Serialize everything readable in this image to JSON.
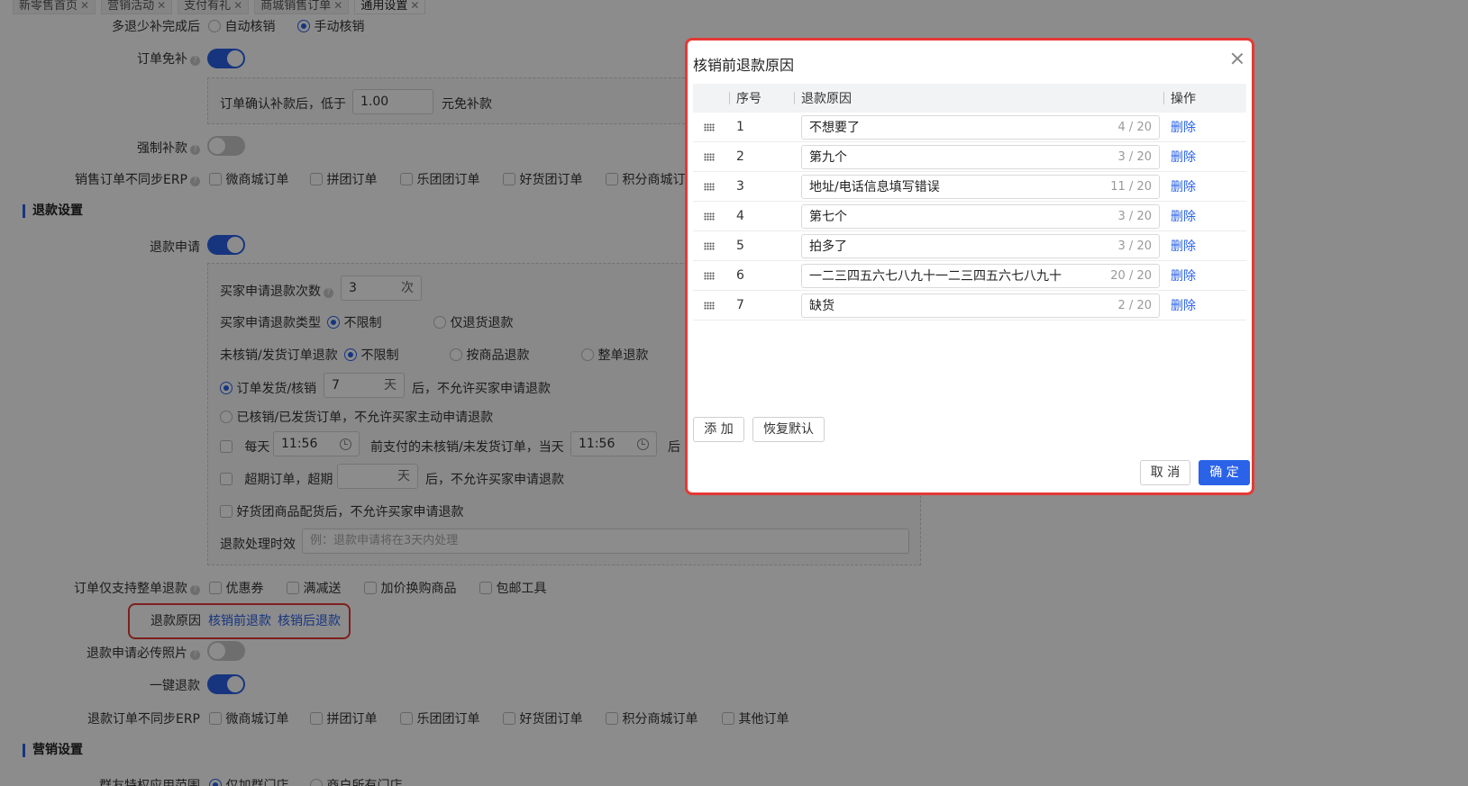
{
  "tabs": [
    {
      "label": "新零售首页",
      "active": false
    },
    {
      "label": "营销活动",
      "active": false
    },
    {
      "label": "支付有礼",
      "active": false
    },
    {
      "label": "商城销售订单",
      "active": false
    },
    {
      "label": "通用设置",
      "active": true
    }
  ],
  "tab_close": "✕",
  "settings": {
    "multi_refund": {
      "label": "多退少补完成后",
      "opt_auto": "自动核销",
      "opt_manual": "手动核销"
    },
    "exempt": {
      "label": "订单免补",
      "box_prefix": "订单确认补款后，低于",
      "value": "1.00",
      "box_suffix": "元免补款"
    },
    "force_refund": {
      "label": "强制补款"
    },
    "erp_sync": {
      "label": "销售订单不同步ERP",
      "options": [
        "微商城订单",
        "拼团订单",
        "乐团团订单",
        "好货团订单",
        "积分商城订"
      ]
    },
    "refund_section": "退款设置",
    "refund_apply": {
      "label": "退款申请"
    },
    "buyer_count": {
      "label": "买家申请退款次数",
      "value": "3",
      "unit": "次"
    },
    "buyer_type": {
      "label": "买家申请退款类型",
      "opt1": "不限制",
      "opt2": "仅退货退款"
    },
    "unverified": {
      "label": "未核销/发货订单退款",
      "opt1": "不限制",
      "opt2": "按商品退款",
      "opt3": "整单退款"
    },
    "after_ship": {
      "prefix": "订单发货/核销",
      "value": "7",
      "unit": "天",
      "suffix": "后，不允许买家申请退款"
    },
    "verified_no": "已核销/已发货订单，不允许买家主动申请退款",
    "daily": {
      "prefix": "每天",
      "time1": "11:56",
      "mid": "前支付的未核销/未发货订单，当天",
      "time2": "11:56",
      "suffix": "后"
    },
    "overdue": {
      "prefix": "超期订单，超期",
      "unit": "天",
      "suffix": "后，不允许买家申请退款"
    },
    "group_goods": "好货团商品配货后，不允许买家申请退款",
    "process_time": {
      "label": "退款处理时效",
      "placeholder": "例：退款申请将在3天内处理"
    },
    "whole_only": {
      "label": "订单仅支持整单退款",
      "options": [
        "优惠券",
        "满减送",
        "加价换购商品",
        "包邮工具"
      ]
    },
    "refund_reason": {
      "label": "退款原因",
      "link1": "核销前退款",
      "link2": "核销后退款"
    },
    "photo_required": {
      "label": "退款申请必传照片"
    },
    "one_click": {
      "label": "一键退款"
    },
    "refund_erp": {
      "label": "退款订单不同步ERP",
      "options": [
        "微商城订单",
        "拼团订单",
        "乐团团订单",
        "好货团订单",
        "积分商城订单",
        "其他订单"
      ]
    },
    "marketing_section": "营销设置",
    "group_scope": {
      "label": "群友特权应用范围",
      "opt1": "仅加群门店",
      "opt2": "商户所有门店"
    }
  },
  "modal": {
    "title": "核销前退款原因",
    "headers": {
      "num": "序号",
      "reason": "退款原因",
      "op": "操作"
    },
    "rows": [
      {
        "num": "1",
        "reason": "不想要了",
        "count": "4 / 20",
        "op": "删除"
      },
      {
        "num": "2",
        "reason": "第九个",
        "count": "3 / 20",
        "op": "删除"
      },
      {
        "num": "3",
        "reason": "地址/电话信息填写错误",
        "count": "11 / 20",
        "op": "删除"
      },
      {
        "num": "4",
        "reason": "第七个",
        "count": "3 / 20",
        "op": "删除"
      },
      {
        "num": "5",
        "reason": "拍多了",
        "count": "3 / 20",
        "op": "删除"
      },
      {
        "num": "6",
        "reason": "一二三四五六七八九十一二三四五六七八九十",
        "count": "20 / 20",
        "op": "删除"
      },
      {
        "num": "7",
        "reason": "缺货",
        "count": "2 / 20",
        "op": "删除"
      }
    ],
    "add_label": "添 加",
    "reset_label": "恢复默认",
    "cancel_label": "取 消",
    "ok_label": "确 定"
  },
  "colors": {
    "accent": "#2a62e8",
    "highlight": "#e53935"
  }
}
